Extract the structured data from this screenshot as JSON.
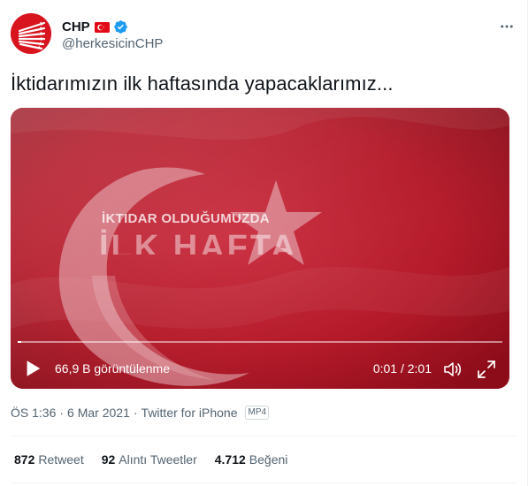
{
  "author": {
    "display_name": "CHP",
    "handle": "@herkesicinCHP",
    "verified": true
  },
  "tweet": {
    "text": "İktidarımızın ilk haftasında yapacaklarımız..."
  },
  "video": {
    "overlay_line1": "İKTIDAR OLDUĞUMUZDA",
    "overlay_line2": "İLK HAFTA",
    "views": "66,9 B görüntülenme",
    "time": "0:01 / 2:01",
    "progress": 0.008
  },
  "meta": {
    "time": "ÖS 1:36",
    "separator": "·",
    "date": "6 Mar 2021",
    "source": "Twitter for iPhone",
    "badge": "MP4"
  },
  "stats": {
    "retweets_count": "872",
    "retweets_label": "Retweet",
    "quotes_count": "92",
    "quotes_label": "Alıntı Tweetler",
    "likes_count": "4.712",
    "likes_label": "Beğeni"
  },
  "colors": {
    "brand_red": "#d8141f",
    "verified_blue": "#1d9bf0",
    "muted_text": "#536471"
  },
  "icons": {
    "avatar": "chp-six-arrows-logo",
    "flag": "turkey-flag-icon",
    "verified": "verified-badge-icon",
    "more": "more-options-icon",
    "play": "play-icon",
    "volume": "volume-icon",
    "fullscreen": "fullscreen-icon"
  }
}
